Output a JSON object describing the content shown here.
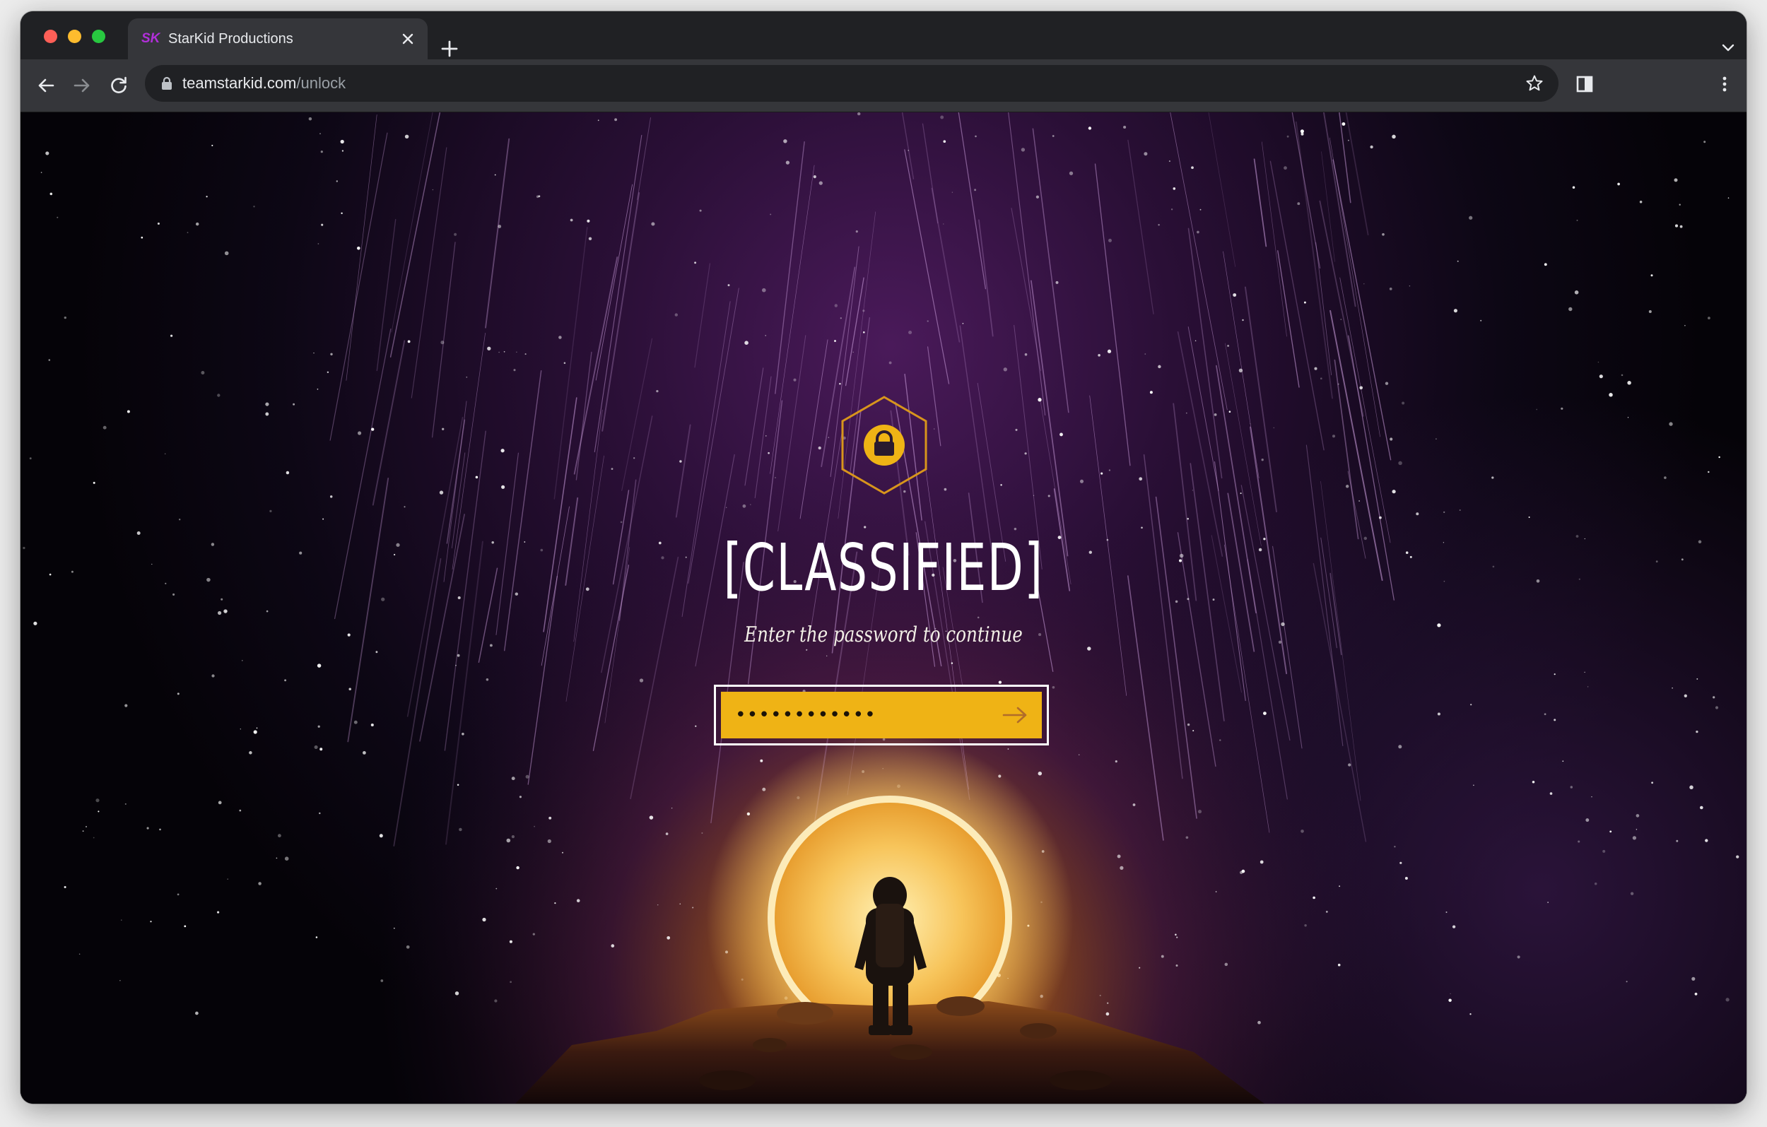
{
  "browser": {
    "tab": {
      "favicon_text": "SK",
      "title": "StarKid Productions"
    },
    "url": {
      "host": "teamstarkid.com",
      "path": "/unlock"
    }
  },
  "page": {
    "headline": "[CLASSIFIED]",
    "subtitle": "Enter the password to continue",
    "password": {
      "value": "••••••••••••",
      "masked": true
    }
  },
  "colors": {
    "accent_gold": "#efb315",
    "favicon_purple": "#b12fd9",
    "sky_purple": "#4a1a5a"
  },
  "icons": [
    "lock-icon",
    "arrow-right-icon",
    "back-arrow-icon",
    "forward-arrow-icon",
    "reload-icon",
    "star-icon",
    "sidebar-icon",
    "kebab-menu-icon",
    "close-icon",
    "plus-icon",
    "chevron-down-icon"
  ]
}
